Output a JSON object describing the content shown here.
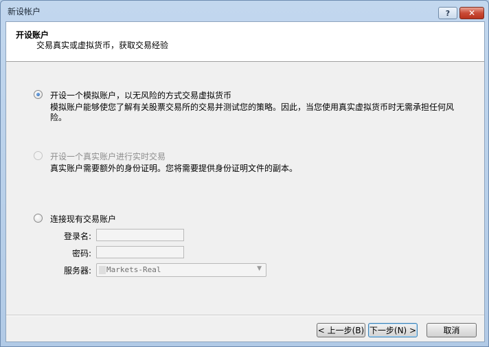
{
  "window": {
    "title": "新设帐户",
    "help_label": "?",
    "close_label": "✕"
  },
  "header": {
    "title": "开设账户",
    "subtitle": "交易真实或虚拟货币，获取交易经验"
  },
  "options": {
    "demo": {
      "label": "开设一个模拟账户，以无风险的方式交易虚拟货币",
      "description": "模拟账户能够使您了解有关股票交易所的交易并测试您的策略。因此，当您使用真实虚拟货币时无需承担任何风险。",
      "selected": true
    },
    "real": {
      "label": "开设一个真实账户进行实时交易",
      "description": "真实账户需要额外的身份证明。您将需要提供身份证明文件的副本。",
      "selected": false
    },
    "existing": {
      "label": "连接现有交易账户",
      "selected": false,
      "login_label": "登录名:",
      "login_value": "",
      "password_label": "密码:",
      "password_value": "",
      "server_label": "服务器:",
      "server_value": "Markets-Real"
    }
  },
  "buttons": {
    "back": "< 上一步(B)",
    "next": "下一步(N) >",
    "cancel": "取消"
  },
  "colors": {
    "window_frame": "#b9d1ea",
    "close_button": "#c94b36",
    "radio_selected": "#1f5fb0"
  }
}
